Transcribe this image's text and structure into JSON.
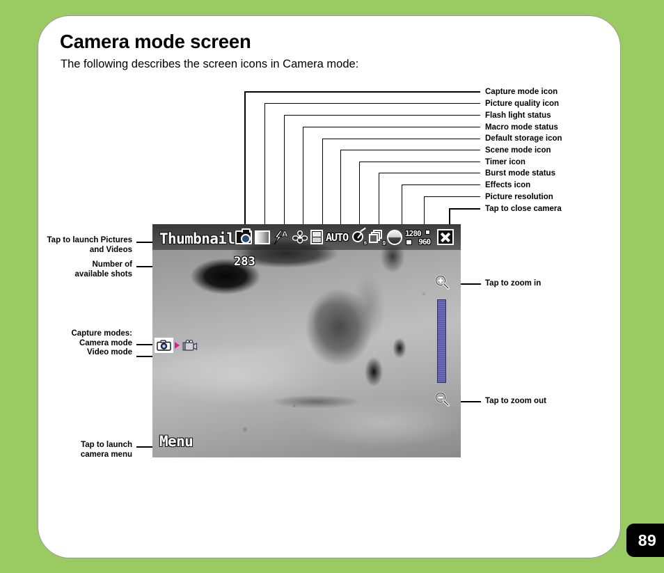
{
  "page": {
    "number": "89",
    "bg_color": "#9acb62",
    "card_color": "#ffffff"
  },
  "heading": {
    "title": "Camera mode screen",
    "subtitle": "The following describes the screen icons in Camera mode:"
  },
  "right_callouts": [
    {
      "label": "Capture mode icon"
    },
    {
      "label": "Picture quality icon"
    },
    {
      "label": "Flash light status"
    },
    {
      "label": "Macro mode status"
    },
    {
      "label": "Default storage icon"
    },
    {
      "label": "Scene mode icon"
    },
    {
      "label": "Timer icon"
    },
    {
      "label": "Burst mode status"
    },
    {
      "label": "Effects icon"
    },
    {
      "label": "Picture resolution"
    },
    {
      "label": "Tap to close camera"
    }
  ],
  "left_callouts": {
    "thumbnails": "Tap to launch Pictures\nand Videos",
    "thumbnails_line1": "Tap to launch Pictures",
    "thumbnails_line2": "and Videos",
    "shots_line1": "Number of",
    "shots_line2": "available shots",
    "capture_modes_title": "Capture modes:",
    "camera_mode": "Camera mode",
    "video_mode": "Video mode",
    "menu_line1": "Tap to launch",
    "menu_line2": "camera menu"
  },
  "right_zoom_callouts": {
    "zoom_in": "Tap to zoom in",
    "zoom_out": "Tap to zoom out"
  },
  "device_screen": {
    "thumbnails_label": "Thumbnails",
    "available_shots": "283",
    "menu_label": "Menu",
    "osd_icons": [
      {
        "name": "capture-mode-icon",
        "value": "camera"
      },
      {
        "name": "picture-quality-icon",
        "value": "gradient-square"
      },
      {
        "name": "flash-light-status-icon",
        "value": "A"
      },
      {
        "name": "macro-mode-status-icon",
        "value": "flower"
      },
      {
        "name": "default-storage-icon",
        "value": "memory"
      },
      {
        "name": "scene-mode-icon",
        "value": "AUTO"
      },
      {
        "name": "timer-icon",
        "value": "s"
      },
      {
        "name": "burst-mode-status-icon",
        "value": "9"
      },
      {
        "name": "effects-icon",
        "value": "circle"
      },
      {
        "name": "picture-resolution-icon",
        "value_top": "1280",
        "value_bottom": "960"
      },
      {
        "name": "close-camera-icon",
        "value": "X"
      }
    ],
    "resolution_top": "1280",
    "resolution_bottom": "960",
    "scene_mode": "AUTO",
    "timer_suffix": "s",
    "burst_count": "9",
    "slider_color": "#5c5ca8",
    "mode_arrow_color": "#e8178f"
  }
}
